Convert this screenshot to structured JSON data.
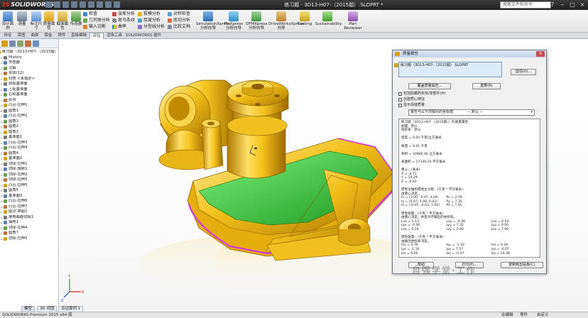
{
  "app": {
    "brand_text": "SOLIDWORKS",
    "window_title": "练习题 - 3D13-H07-（2015题）.SLDPRT *",
    "search_placeholder": "搜索文件和命令"
  },
  "ribbon": {
    "large": [
      {
        "label": "设计算例"
      },
      {
        "label": "测量"
      },
      {
        "label": "标注尺寸"
      },
      {
        "label": "质量属性"
      },
      {
        "label": "截面属性"
      },
      {
        "label": "传感器"
      }
    ],
    "col1": [
      {
        "label": "检查"
      },
      {
        "label": "几何体分析"
      },
      {
        "label": "输入诊断"
      }
    ],
    "col2": [
      {
        "label": "误差分析"
      },
      {
        "label": "斑马条纹"
      },
      {
        "label": "曲率"
      }
    ],
    "col3": [
      {
        "label": "拔模分析"
      },
      {
        "label": "厚度分析"
      },
      {
        "label": "分型线分析"
      }
    ],
    "col4": [
      {
        "label": "对称检查"
      },
      {
        "label": "底切分析"
      },
      {
        "label": "比较文档"
      }
    ],
    "tools": [
      {
        "label": "SimulationXpress分析向导"
      },
      {
        "label": "FloXpress分析向导"
      },
      {
        "label": "DFMXpress分析向导"
      },
      {
        "label": "DriveWorksXpress向导"
      },
      {
        "label": "Costing"
      },
      {
        "label": "Sustainability"
      },
      {
        "label": "Part Reviewer"
      }
    ]
  },
  "tabs": [
    "特征",
    "草图",
    "曲面",
    "钣金",
    "焊件",
    "直接编辑",
    "评估",
    "渲染工具",
    "SOLIDWORKS 插件"
  ],
  "active_tab": "评估",
  "tree": [
    "练习题（3D13-H07-（2015题）",
    "History",
    "传感器",
    "注解",
    "实体(12)",
    "材质 <未指定>",
    "前视基准面",
    "上视基准面",
    "右视基准面",
    "原点",
    "凸台-拉伸1",
    "圆角1",
    "凸台-拉伸2",
    "圆角1",
    "圆角2",
    "圆角3",
    "基准面1",
    "凸台-拉伸3",
    "凸台-拉伸4",
    "圆角4",
    "基准面2",
    "切除-拉伸1",
    "切除-旋转1",
    "切除-拉伸2",
    "切除-拉伸3",
    "凸台-拉伸5",
    "圆角5",
    "基准面3",
    "凸台-拉伸6",
    "凸台-拉伸7",
    "圆顶-草图1",
    "使用曲面切除1",
    "抽壳1",
    "切除-拉伸4",
    "圆角7",
    "切除-拉伸5"
  ],
  "dialog": {
    "title": "质量属性",
    "selection": "练习题（3D13-H07-（2015题）.SLDPRT",
    "options_btn": "选项(O)...",
    "override_btn": "覆盖质量属性...",
    "recalc_btn": "重算(R)",
    "cb1": "包括隐藏的实体/零部件(H)",
    "cb2": "创建质心特征",
    "cb3": "显示焊缝质量",
    "coord_label": "报告与以下项相对的坐标值：",
    "coord_value": "-- 默认 --",
    "results_top": [
      "练习题（3D13-H07-（2015题））的质量属性",
      "配置：默认",
      "坐标系：默认",
      "",
      "密度 = 0.00 千克/立方毫米",
      "",
      "质量 = 0.01 千克",
      "",
      "体积 = 10969.46 立方毫米",
      "",
      "表面积 = 17339.24 平方毫米",
      "",
      "重心：(毫米)",
      "X = -4.71",
      "Y = 14.29",
      "Z = -0.42",
      "",
      "惯性主轴和惯性主力矩：(千克 * 平方毫米)",
      "由重心决定。"
    ],
    "principal": [
      [
        "Ix = (1.00, -0.07, 0.04)",
        "Px = 2.59"
      ],
      [
        "Iy = (0.07, 1.00, 0.02)",
        "Py = 7.35"
      ],
      [
        "Iz = (-0.05, -0.03, 1.00)",
        "Pz = 7.91"
      ]
    ],
    "results_mid1": [
      "惯性张量：(千克 * 平方毫米)",
      "由重心决定，并且对齐输出的坐标系。"
    ],
    "tensor1": [
      [
        "Lxx = 2.13",
        "Lxy = -0.36",
        "Lxz = 0.24"
      ],
      [
        "Lyx = -0.36",
        "Lyy = 7.32",
        "Lyz = 0.00"
      ],
      [
        "Lzx = 0.24",
        "Lzy = 0.00",
        "Lzz = 7.90"
      ]
    ],
    "results_mid2": [
      "惯性张量：(千克 * 平方毫米)",
      "由输出坐标系决定。"
    ],
    "tensor2": [
      [
        "Ixx = 4.76",
        "Ixy = -1.10",
        "Ixz = 0.26"
      ],
      [
        "Iyx = -1.10",
        "Iyy = 7.57",
        "Iyz = -0.07"
      ],
      [
        "Izx = 0.26",
        "Izy = -0.07",
        "Izz = 10.38"
      ]
    ],
    "help_btn": "帮助",
    "print_btn": "打印(P)...",
    "copy_btn": "复制到剪贴板(C)"
  },
  "status": {
    "left": "SOLIDWORKS Premium 2015 x64 版",
    "right1": "在编辑",
    "right2": "零件",
    "right3": "自定义"
  },
  "bottom_tabs": [
    "模型",
    "3D 视图",
    "运动算例 1"
  ],
  "watermark": "自强学堂·工作",
  "colors": {
    "part": "#f2c01a",
    "part_dark": "#b88600",
    "face_green": "#3ec43e",
    "face_magenta": "#d040d0",
    "ui_blue": "#3a78c8"
  }
}
